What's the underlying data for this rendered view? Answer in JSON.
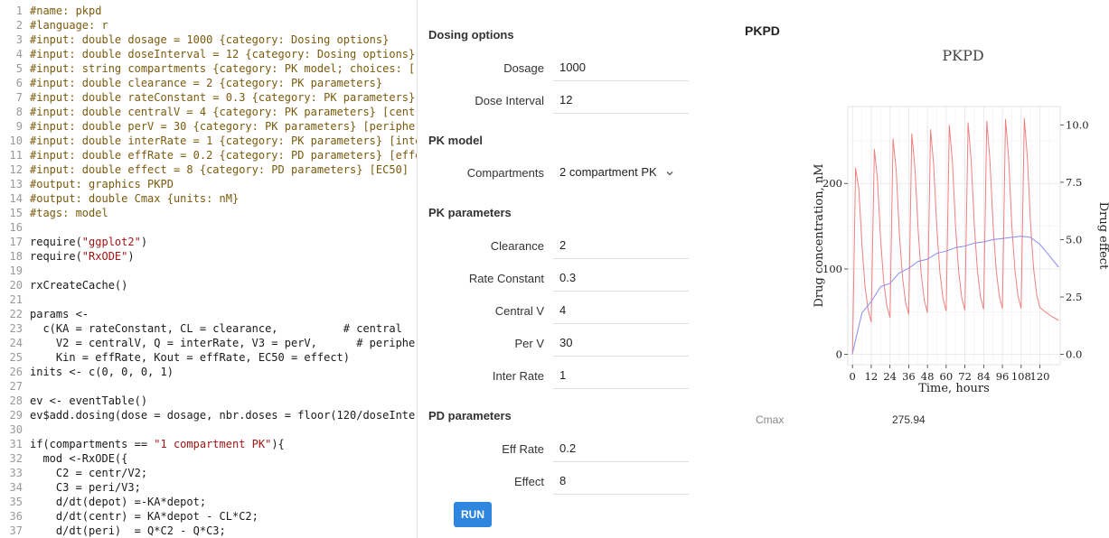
{
  "code_lines": [
    {
      "n": "1",
      "t": "#name: pkpd",
      "k": "comment"
    },
    {
      "n": "2",
      "t": "#language: r",
      "k": "comment"
    },
    {
      "n": "3",
      "t": "#input: double dosage = 1000 {category: Dosing options}",
      "k": "comment"
    },
    {
      "n": "4",
      "t": "#input: double doseInterval = 12 {category: Dosing options}",
      "k": "comment"
    },
    {
      "n": "5",
      "t": "#input: string compartments {category: PK model; choices: ['",
      "k": "comment"
    },
    {
      "n": "6",
      "t": "#input: double clearance = 2 {category: PK parameters}",
      "k": "comment"
    },
    {
      "n": "7",
      "t": "#input: double rateConstant = 0.3 {category: PK parameters}",
      "k": "comment"
    },
    {
      "n": "8",
      "t": "#input: double centralV = 4 {category: PK parameters} [centr",
      "k": "comment"
    },
    {
      "n": "9",
      "t": "#input: double perV = 30 {category: PK parameters} [peripher",
      "k": "comment"
    },
    {
      "n": "10",
      "t": "#input: double interRate = 1 {category: PK parameters} [inte",
      "k": "comment"
    },
    {
      "n": "11",
      "t": "#input: double effRate = 0.2 {category: PD parameters} [effe",
      "k": "comment"
    },
    {
      "n": "12",
      "t": "#input: double effect = 8 {category: PD parameters} [EC50]",
      "k": "comment"
    },
    {
      "n": "13",
      "t": "#output: graphics PKPD",
      "k": "comment"
    },
    {
      "n": "14",
      "t": "#output: double Cmax {units: nM}",
      "k": "comment"
    },
    {
      "n": "15",
      "t": "#tags: model",
      "k": "comment"
    },
    {
      "n": "16",
      "t": "",
      "k": "code"
    },
    {
      "n": "17",
      "t": "require(\"ggplot2\")",
      "k": "code"
    },
    {
      "n": "18",
      "t": "require(\"RxODE\")",
      "k": "code"
    },
    {
      "n": "19",
      "t": "",
      "k": "code"
    },
    {
      "n": "20",
      "t": "rxCreateCache()",
      "k": "code"
    },
    {
      "n": "21",
      "t": "",
      "k": "code"
    },
    {
      "n": "22",
      "t": "params <-",
      "k": "code"
    },
    {
      "n": "23",
      "t": "  c(KA = rateConstant, CL = clearance,          # central",
      "k": "code"
    },
    {
      "n": "24",
      "t": "    V2 = centralV, Q = interRate, V3 = perV,      # peripher",
      "k": "code"
    },
    {
      "n": "25",
      "t": "    Kin = effRate, Kout = effRate, EC50 = effect)",
      "k": "code"
    },
    {
      "n": "26",
      "t": "inits <- c(0, 0, 0, 1)",
      "k": "code"
    },
    {
      "n": "27",
      "t": "",
      "k": "code"
    },
    {
      "n": "28",
      "t": "ev <- eventTable()",
      "k": "code"
    },
    {
      "n": "29",
      "t": "ev$add.dosing(dose = dosage, nbr.doses = floor(120/doseInter",
      "k": "code"
    },
    {
      "n": "30",
      "t": "",
      "k": "code"
    },
    {
      "n": "31",
      "t": "if(compartments == \"1 compartment PK\"){",
      "k": "code"
    },
    {
      "n": "32",
      "t": "  mod <-RxODE({",
      "k": "code"
    },
    {
      "n": "33",
      "t": "    C2 = centr/V2;",
      "k": "code"
    },
    {
      "n": "34",
      "t": "    C3 = peri/V3;",
      "k": "code"
    },
    {
      "n": "35",
      "t": "    d/dt(depot) =-KA*depot;",
      "k": "code"
    },
    {
      "n": "36",
      "t": "    d/dt(centr) = KA*depot - CL*C2;",
      "k": "code"
    },
    {
      "n": "37",
      "t": "    d/dt(peri)  = Q*C2 - Q*C3;",
      "k": "code"
    }
  ],
  "form": {
    "dosing_header": "Dosing options",
    "dosage_label": "Dosage",
    "dosage_value": "1000",
    "dose_interval_label": "Dose Interval",
    "dose_interval_value": "12",
    "pk_model_header": "PK model",
    "compartments_label": "Compartments",
    "compartments_value": "2 compartment PK",
    "pk_params_header": "PK parameters",
    "clearance_label": "Clearance",
    "clearance_value": "2",
    "rate_constant_label": "Rate Constant",
    "rate_constant_value": "0.3",
    "central_v_label": "Central V",
    "central_v_value": "4",
    "per_v_label": "Per V",
    "per_v_value": "30",
    "inter_rate_label": "Inter Rate",
    "inter_rate_value": "1",
    "pd_params_header": "PD parameters",
    "eff_rate_label": "Eff Rate",
    "eff_rate_value": "0.2",
    "effect_label": "Effect",
    "effect_value": "8",
    "run_label": "RUN"
  },
  "output": {
    "title": "PKPD",
    "cmax_label": "Cmax",
    "cmax_value": "275.94"
  },
  "colors": {
    "concentration": "#f08080",
    "effect": "#8c8cf0",
    "comment": "#7a5b0d",
    "string": "#a31515",
    "run_button": "#2e86de"
  },
  "chart_data": {
    "type": "line",
    "title": "PKPD",
    "xlabel": "Time, hours",
    "ylabel": "Drug concentration, nM",
    "y2label": "Drug effect",
    "xlim": [
      -3,
      133
    ],
    "ylim": [
      -12,
      290
    ],
    "y2lim": [
      -0.45,
      10.8
    ],
    "x_ticks": [
      "0",
      "12",
      "24",
      "36",
      "48",
      "60",
      "72",
      "84",
      "96",
      "108",
      "120"
    ],
    "x_tick_values": [
      0,
      12,
      24,
      36,
      48,
      60,
      72,
      84,
      96,
      108,
      120
    ],
    "y_ticks": [
      "0",
      "100",
      "200"
    ],
    "y_tick_values": [
      0,
      100,
      200
    ],
    "y2_ticks": [
      "0.0",
      "2.5",
      "5.0",
      "7.5",
      "10.0"
    ],
    "y2_tick_values": [
      0,
      2.5,
      5,
      7.5,
      10
    ],
    "grid": true,
    "series": [
      {
        "axis": "left",
        "x": [
          0,
          2,
          4,
          6,
          8,
          10,
          12,
          14,
          16,
          18,
          20,
          22,
          24,
          26,
          28,
          30,
          32,
          34,
          36,
          38,
          40,
          42,
          44,
          46,
          48,
          50,
          52,
          54,
          56,
          58,
          60,
          62,
          64,
          66,
          68,
          70,
          72,
          74,
          76,
          78,
          80,
          82,
          84,
          86,
          88,
          90,
          92,
          94,
          96,
          98,
          100,
          102,
          104,
          106,
          108,
          110,
          112,
          114,
          116,
          118,
          120,
          124,
          128,
          132
        ],
        "y": [
          0,
          218,
          195,
          130,
          80,
          52,
          38,
          240,
          205,
          135,
          86,
          57,
          43,
          252,
          215,
          142,
          91,
          61,
          47,
          258,
          218,
          146,
          94,
          63,
          49,
          263,
          222,
          148,
          96,
          65,
          51,
          268,
          225,
          150,
          97,
          66,
          52,
          271,
          227,
          151,
          98,
          67,
          53,
          273,
          228,
          152,
          99,
          68,
          54,
          275,
          229,
          152,
          99,
          68,
          54,
          276,
          230,
          153,
          100,
          69,
          55,
          49,
          44,
          40
        ]
      },
      {
        "axis": "right",
        "x": [
          0,
          6,
          12,
          18,
          24,
          30,
          36,
          42,
          48,
          54,
          60,
          66,
          72,
          78,
          84,
          90,
          96,
          102,
          108,
          114,
          120,
          126,
          132
        ],
        "y": [
          0.05,
          1.8,
          2.3,
          2.95,
          3.1,
          3.55,
          3.75,
          4.05,
          4.15,
          4.4,
          4.5,
          4.65,
          4.72,
          4.85,
          4.9,
          5.0,
          5.05,
          5.1,
          5.15,
          5.1,
          4.8,
          4.3,
          3.8
        ]
      }
    ]
  }
}
